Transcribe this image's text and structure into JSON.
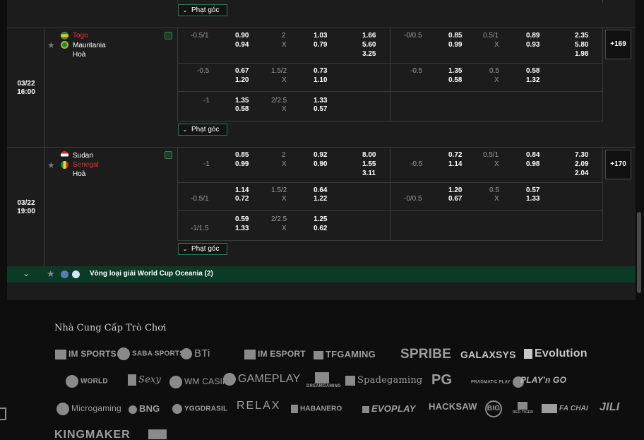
{
  "corner_label": "Phạt góc",
  "matches": [
    {
      "id": "m1",
      "date": "03/22",
      "time": "16:00",
      "home": "Togo",
      "away": "Mauritania",
      "draw": "Hoà",
      "more": "+169",
      "rows": [
        {
          "h1": "-0.5/1",
          "h1o": [
            "0.90",
            "0.94"
          ],
          "ou1": [
            "2",
            "X"
          ],
          "ou1o": [
            "1.03",
            "0.79"
          ],
          "x12": [
            "1.66",
            "5.60",
            "3.25"
          ],
          "h2": "-0/0.5",
          "h2o": [
            "0.85",
            "0.99"
          ],
          "ou2": [
            "0.5/1",
            "X"
          ],
          "ou2o": [
            "0.89",
            "0.93"
          ],
          "x12b": [
            "2.35",
            "5.80",
            "1.98"
          ]
        },
        {
          "h1": "-0.5",
          "h1o": [
            "0.67",
            "1.20"
          ],
          "ou1": [
            "1.5/2",
            "X"
          ],
          "ou1o": [
            "0.73",
            "1.10"
          ],
          "h2": "-0.5",
          "h2o": [
            "1.35",
            "0.58"
          ],
          "ou2": [
            "0.5",
            "X"
          ],
          "ou2o": [
            "0.58",
            "1.32"
          ]
        },
        {
          "h1": "-1",
          "h1o": [
            "1.35",
            "0.58"
          ],
          "ou1": [
            "2/2.5",
            "X"
          ],
          "ou1o": [
            "1.33",
            "0.57"
          ]
        }
      ]
    },
    {
      "id": "m2",
      "date": "03/22",
      "time": "19:00",
      "home": "Sudan",
      "away": "Senegal",
      "draw": "Hoà",
      "more": "+170",
      "rows": [
        {
          "h1": "-1",
          "h1o": [
            "0.85",
            "0.99"
          ],
          "ou1": [
            "2",
            "X"
          ],
          "ou1o": [
            "0.92",
            "0.90"
          ],
          "x12": [
            "8.00",
            "1.55",
            "3.11"
          ],
          "h2": "-0.5",
          "h2o": [
            "0.72",
            "1.14"
          ],
          "ou2": [
            "0.5/1",
            "X"
          ],
          "ou2o": [
            "0.84",
            "0.98"
          ],
          "x12b": [
            "7.30",
            "2.09",
            "2.04"
          ]
        },
        {
          "h1": "-0.5/1",
          "h1o": [
            "1.14",
            "0.72"
          ],
          "ou1": [
            "1.5/2",
            "X"
          ],
          "ou1o": [
            "0.64",
            "1.22"
          ],
          "h2": "-0/0.5",
          "h2o": [
            "1.20",
            "0.67"
          ],
          "ou2": [
            "0.5",
            "X"
          ],
          "ou2o": [
            "0.57",
            "1.33"
          ]
        },
        {
          "h1": "-1/1.5",
          "h1o": [
            "0.59",
            "1.33"
          ],
          "ou1": [
            "2/2.5",
            "X"
          ],
          "ou1o": [
            "1.25",
            "0.62"
          ]
        }
      ]
    }
  ],
  "league": {
    "name": "Vòng loại giải World Cup Oceania (2)"
  },
  "footer": {
    "title": "Nhà Cung Cấp Trò Chơi",
    "providers_row1": [
      "IM SPORTS",
      "SABA SPORTS",
      "BTi",
      "IM ESPORT",
      "TFGAMING",
      "SPRIBE",
      "GALAXSYS",
      "Evolution"
    ],
    "providers_row2": [
      "WORLD",
      "Sexy",
      "WM CASINO",
      "GAMEPLAY",
      "DREAMGAMING",
      "Spadegaming",
      "PG",
      "PRAGMATIC PLAY",
      "PLAY'n GO"
    ],
    "providers_row3": [
      "Microgaming",
      "BNG",
      "YGGDRASIL",
      "RELAX",
      "HABANERO",
      "EVOPLAY",
      "HACKSAW",
      "BIG",
      "RED TIGER",
      "FA CHAI",
      "JILI"
    ],
    "providers_row4": [
      "KINGMAKER"
    ]
  },
  "colors": {
    "accent_green": "#0b3a27",
    "border_green": "#2a7a50",
    "red_team": "#e8312a",
    "panel": "#1c1c1c"
  }
}
